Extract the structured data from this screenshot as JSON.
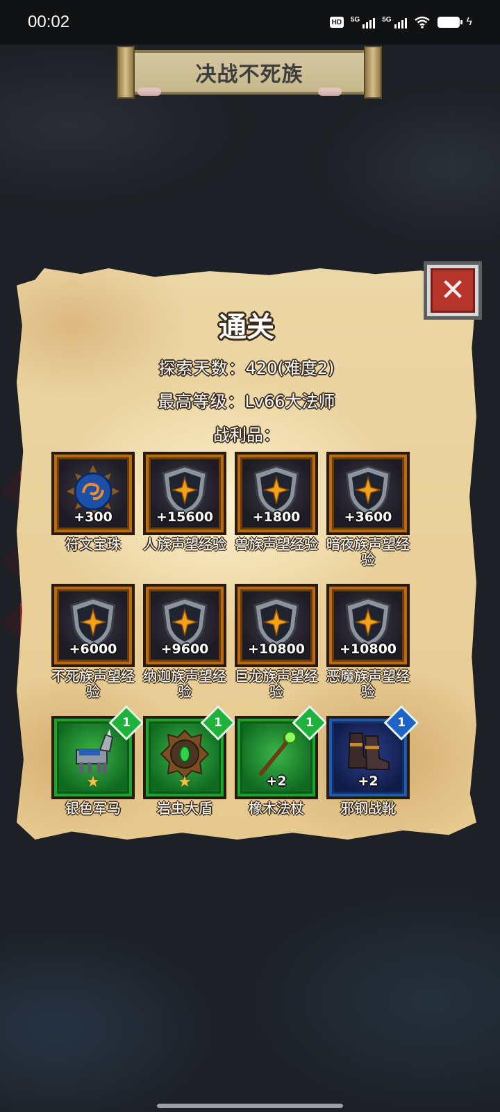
{
  "status_bar": {
    "time": "00:02",
    "hd_label": "HD",
    "signal_1_label": "5G",
    "signal_2_label": "5G"
  },
  "title_scroll": {
    "text": "决战不死族"
  },
  "result_panel": {
    "title": "通关",
    "days_label": "探索天数：",
    "days_value": "420(难度2)",
    "level_label": "最高等级：",
    "level_value": "Lv66大法师",
    "loot_label": "战利品："
  },
  "loot": [
    {
      "name": "符文宝珠",
      "amount": "+300",
      "icon": "rune-orb-icon"
    },
    {
      "name": "人族声望经验",
      "amount": "+15600",
      "icon": "shield-emblem-icon"
    },
    {
      "name": "兽族声望经验",
      "amount": "+1800",
      "icon": "shield-emblem-icon"
    },
    {
      "name": "暗夜族声望经验",
      "amount": "+3600",
      "icon": "shield-emblem-icon"
    },
    {
      "name": "不死族声望经验",
      "amount": "+6000",
      "icon": "shield-emblem-icon"
    },
    {
      "name": "纳迦族声望经验",
      "amount": "+9600",
      "icon": "shield-emblem-icon"
    },
    {
      "name": "巨龙族声望经验",
      "amount": "+10800",
      "icon": "shield-emblem-icon"
    },
    {
      "name": "恶魔族声望经验",
      "amount": "+10800",
      "icon": "shield-emblem-icon"
    },
    {
      "name": "银色军马",
      "level": "1",
      "star": "★",
      "icon": "warhorse-icon",
      "rarity": "green"
    },
    {
      "name": "岩虫大盾",
      "level": "1",
      "star": "★",
      "icon": "shield-gem-icon",
      "rarity": "green"
    },
    {
      "name": "橡木法杖",
      "level": "1",
      "amount": "+2",
      "icon": "staff-icon",
      "rarity": "green"
    },
    {
      "name": "邪钢战靴",
      "level": "1",
      "amount": "+2",
      "icon": "boots-icon",
      "rarity": "blue"
    }
  ],
  "colors": {
    "parchment": "#e9d19c",
    "frame_orange": "#b86b10",
    "rarity_green": "#19a32f",
    "rarity_blue": "#1f5bb3",
    "close_red": "#b6352a"
  }
}
